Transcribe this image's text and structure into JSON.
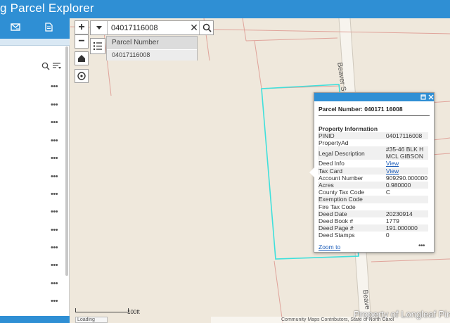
{
  "app": {
    "title": "g Parcel Explorer"
  },
  "colors": {
    "accent": "#2f8fd4",
    "parcel_highlight": "#3fe0dc",
    "parcel_lines": "#e0a39a"
  },
  "toolbar": {
    "icons": [
      "mail-icon",
      "document-icon"
    ]
  },
  "search": {
    "value": "04017116008",
    "suggest_header": "Parcel Number",
    "suggest_item": "04017116008"
  },
  "map": {
    "street_label_1": "Beaver S",
    "street_label_2": "Beave",
    "scale_label": "100ft",
    "loading": "Loading",
    "attribution": "Community Maps Contributors, State of North Carol",
    "watermark": "Property of Longleaf Pin"
  },
  "popup": {
    "title": "Parcel Number: 040171 16008",
    "section": "Property Information",
    "fields": [
      {
        "key": "PINID",
        "value": "04017116008"
      },
      {
        "key": "PropertyAd",
        "value": ""
      },
      {
        "key": "Legal Description",
        "value": "#35-46 BLK H MCL GIBSON"
      },
      {
        "key": "Deed Info",
        "value": "View"
      },
      {
        "key": "Tax Card",
        "value": "View"
      },
      {
        "key": "Account Number",
        "value": "909290.000000"
      },
      {
        "key": "Acres",
        "value": "0.980000"
      },
      {
        "key": "County Tax Code",
        "value": "C"
      },
      {
        "key": "Exemption Code",
        "value": ""
      },
      {
        "key": "Fire Tax Code",
        "value": ""
      },
      {
        "key": "Deed Date",
        "value": "20230914"
      },
      {
        "key": "Deed Book #",
        "value": "1779"
      },
      {
        "key": "Deed Page #",
        "value": "191.000000"
      },
      {
        "key": "Deed Stamps",
        "value": "0"
      }
    ],
    "zoom_link": "Zoom to"
  }
}
